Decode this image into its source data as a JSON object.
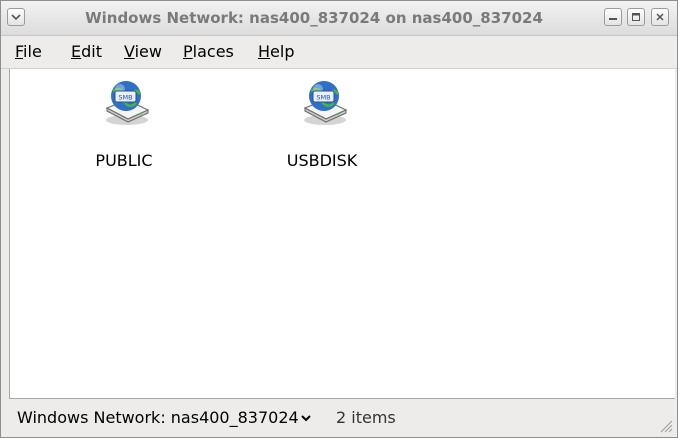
{
  "window": {
    "title": "Windows Network: nas400_837024 on nas400_837024"
  },
  "menubar": {
    "items": [
      {
        "label": "File",
        "mnemonic": "F",
        "rest": "ile"
      },
      {
        "label": "Edit",
        "mnemonic": "E",
        "rest": "dit"
      },
      {
        "label": "View",
        "mnemonic": "V",
        "rest": "iew"
      },
      {
        "label": "Places",
        "mnemonic": "P",
        "rest": "laces"
      },
      {
        "label": "Help",
        "mnemonic": "H",
        "rest": "elp"
      }
    ]
  },
  "content": {
    "items": [
      {
        "label": "PUBLIC",
        "icon": "smb-share-icon",
        "badge": "SMB"
      },
      {
        "label": "USBDISK",
        "icon": "smb-share-icon",
        "badge": "SMB"
      }
    ]
  },
  "statusbar": {
    "location": "Windows Network: nas400_837024",
    "count": "2 items"
  },
  "colors": {
    "titlebar_text": "#7a7a7a",
    "globe": "#2f6fc8",
    "window_bg": "#edecea"
  }
}
